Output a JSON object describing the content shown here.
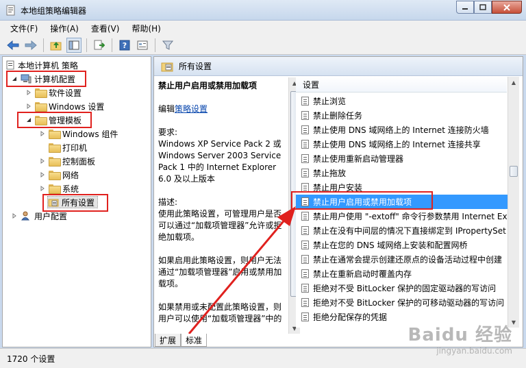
{
  "window": {
    "title": "本地组策略编辑器"
  },
  "menu": [
    "文件(F)",
    "操作(A)",
    "查看(V)",
    "帮助(H)"
  ],
  "toolbar": {
    "icons": [
      "back-arrow-icon",
      "forward-arrow-icon",
      "up-folder-icon",
      "show-hide-tree-icon",
      "export-list-icon",
      "help-icon",
      "properties-icon",
      "filter-icon"
    ]
  },
  "tree": {
    "root": "本地计算机 策略",
    "computer_config": "计算机配置",
    "software_settings": "软件设置",
    "windows_settings": "Windows 设置",
    "admin_templates": "管理模板",
    "windows_components": "Windows 组件",
    "printers": "打印机",
    "control_panel": "控制面板",
    "network": "网络",
    "system": "系统",
    "all_settings": "所有设置",
    "user_config": "用户配置"
  },
  "right_header": {
    "title": "所有设置"
  },
  "description": {
    "title": "禁止用户启用或禁用加载项",
    "edit_prefix": "编辑",
    "edit_link": "策略设置",
    "requirements_label": "要求:",
    "requirements_text": "Windows XP Service Pack 2 或 Windows Server 2003 Service Pack 1 中的 Internet Explorer 6.0 及以上版本",
    "desc_label": "描述:",
    "desc_text": "使用此策略设置，可管理用户是否可以通过“加载项管理器”允许或拒绝加载项。",
    "enabled_text": "如果启用此策略设置，则用户无法通过“加载项管理器”启用或禁用加载项。",
    "disabled_text": "如果禁用或未配置此策略设置，则用户可以使用“加载项管理器”中的相应控件"
  },
  "list": {
    "column_header": "设置",
    "rows": [
      "禁止浏览",
      "禁止删除任务",
      "禁止使用 DNS 域网络上的 Internet 连接防火墙",
      "禁止使用 DNS 域网络上的 Internet 连接共享",
      "禁止使用重新启动管理器",
      "禁止拖放",
      "禁止用户安装",
      "禁止用户启用或禁用加载项",
      "禁止用户使用 \"-extoff\" 命令行参数禁用 Internet Exp",
      "禁止在没有中间层的情况下直接绑定到 IPropertySet",
      "禁止在您的 DNS 域网络上安装和配置网桥",
      "禁止在通常会提示创建还原点的设备活动过程中创建",
      "禁止在重新启动时覆盖内存",
      "拒绝对不受 BitLocker 保护的固定驱动器的写访问",
      "拒绝对不受 BitLocker 保护的可移动驱动器的写访问",
      "拒绝分配保存的凭据"
    ],
    "selected_index": 7
  },
  "tabs": [
    "扩展",
    "标准"
  ],
  "status": "1720 个设置",
  "watermark": {
    "line1": "Baidu 经验",
    "line2": "jingyan.baidu.com"
  }
}
